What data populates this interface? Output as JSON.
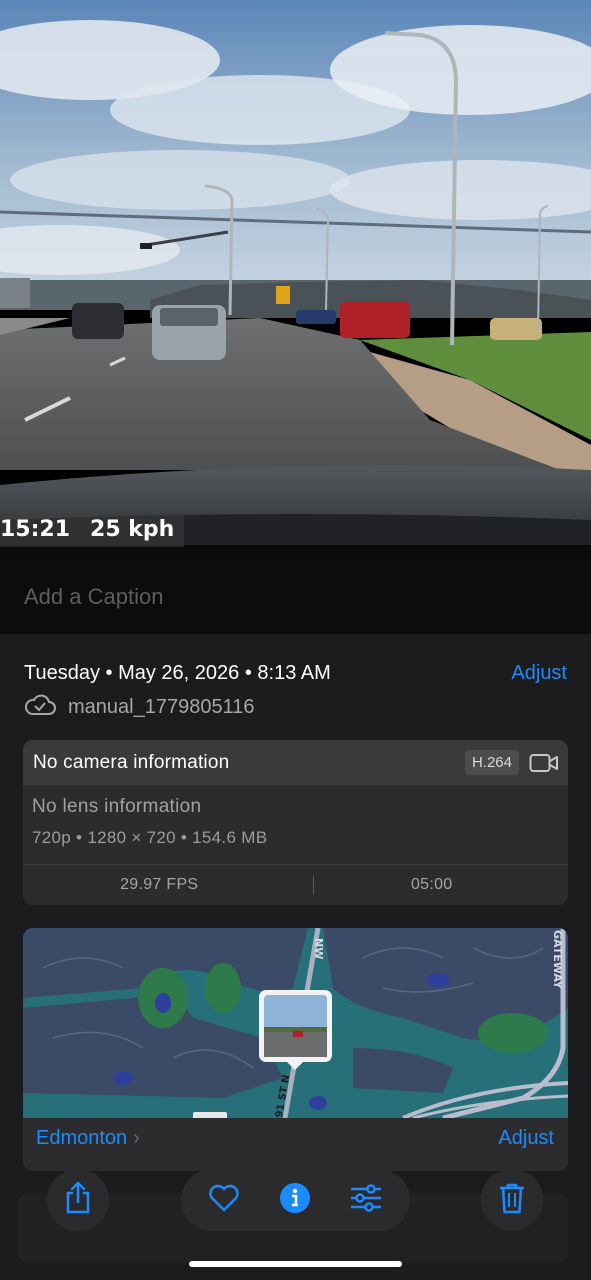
{
  "photo": {
    "time_overlay": "15:21",
    "speed_overlay": "25 kph"
  },
  "caption": {
    "placeholder": "Add a Caption"
  },
  "info": {
    "date": "Tuesday • May 26, 2026 • 8:13 AM",
    "adjust_label": "Adjust",
    "file_name": "manual_1779805116"
  },
  "camera": {
    "title": "No camera information",
    "codec": "H.264",
    "lens": "No lens information",
    "specs": "720p • 1280 × 720 • 154.6 MB",
    "fps": "29.97 FPS",
    "duration": "05:00"
  },
  "map": {
    "location": "Edmonton",
    "adjust_label": "Adjust",
    "road_labels": [
      "GATEWAY",
      "NW",
      "91 ST N"
    ]
  },
  "toolbar": {
    "icons": [
      "share-icon",
      "heart-icon",
      "info-icon",
      "adjust-icon",
      "trash-icon"
    ]
  },
  "colors": {
    "accent": "#1b8bff",
    "panel_bg": "#1c1c1e",
    "card_bg": "#2c2c2e"
  }
}
